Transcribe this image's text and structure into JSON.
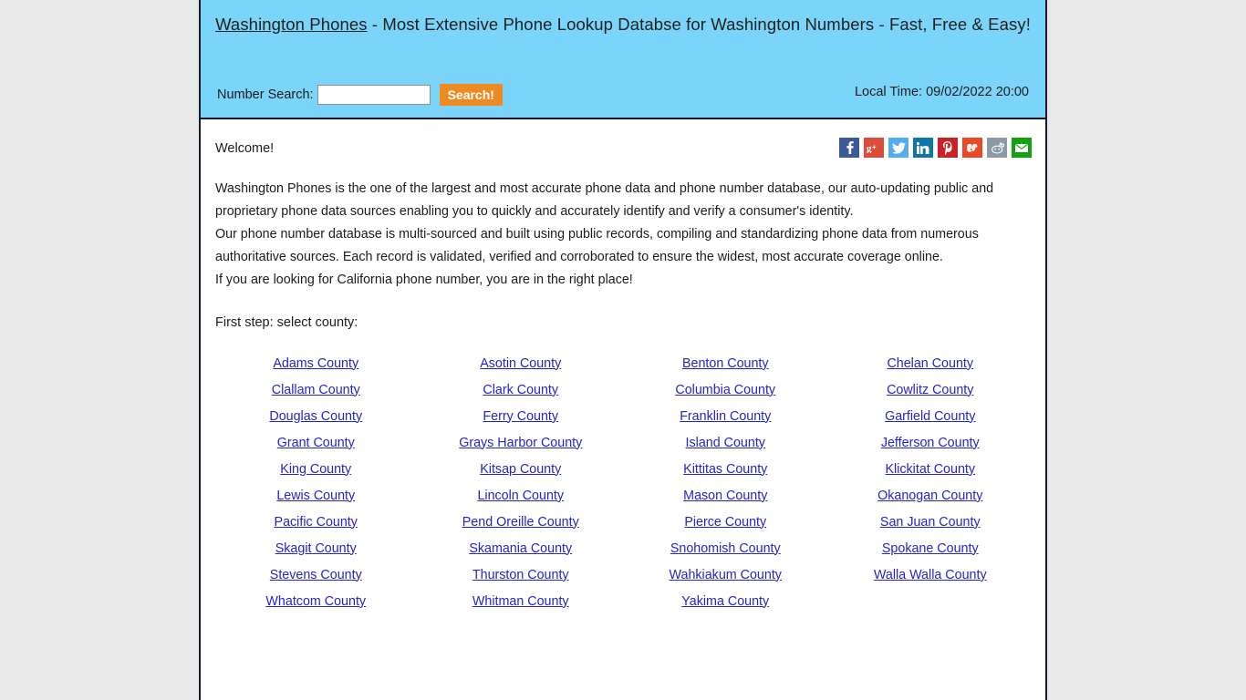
{
  "header": {
    "brand": "Washington Phones",
    "title_rest": " - Most Extensive Phone Lookup Databse for Washington Numbers - Fast, Free & Easy!",
    "search_label": "Number Search:",
    "search_value": "",
    "search_placeholder": "",
    "search_button": "Search!",
    "local_time": "Local Time: 09/02/2022 20:00",
    "colors": {
      "background": "#7bd5fb",
      "button": "#ef8a22"
    }
  },
  "content": {
    "welcome": "Welcome!",
    "paragraphs": [
      "Washington Phones is the one of the largest and most accurate phone data and phone number database, our auto-updating public and",
      "proprietary phone data sources enabling you to quickly and accurately identify and verify a consumer's identity.",
      "Our phone number database is multi-sourced and built using public records, compiling and standardizing phone data from numerous",
      "authoritative sources. Each record is validated, verified and corroborated to ensure the widest, most accurate coverage online.",
      "If you are looking for California phone number, you are in the right place!"
    ],
    "first_step": "First step: select county:",
    "link_color": "#2525c8"
  },
  "social": [
    {
      "name": "facebook-icon",
      "label": "f",
      "color": "#3b5998"
    },
    {
      "name": "googleplus-icon",
      "label": "g+",
      "color": "#dd4b39"
    },
    {
      "name": "twitter-icon",
      "label": "t",
      "color": "#55acee"
    },
    {
      "name": "linkedin-icon",
      "label": "in",
      "color": "#0e76a8"
    },
    {
      "name": "pinterest-icon",
      "label": "p",
      "color": "#cb2027"
    },
    {
      "name": "stumbleupon-icon",
      "label": "su",
      "color": "#eb4924"
    },
    {
      "name": "reddit-icon",
      "label": "r",
      "color": "#8b9aa5"
    },
    {
      "name": "email-icon",
      "label": "@",
      "color": "#13a10e"
    }
  ],
  "counties": {
    "rows": [
      [
        "Adams County",
        "Asotin County",
        "Benton County",
        "Chelan County"
      ],
      [
        "Clallam County",
        "Clark County",
        "Columbia County",
        "Cowlitz County"
      ],
      [
        "Douglas County",
        "Ferry County",
        "Franklin County",
        "Garfield County"
      ],
      [
        "Grant County",
        "Grays Harbor County",
        "Island County",
        "Jefferson County"
      ],
      [
        "King County",
        "Kitsap County",
        "Kittitas County",
        "Klickitat County"
      ],
      [
        "Lewis County",
        "Lincoln County",
        "Mason County",
        "Okanogan County"
      ],
      [
        "Pacific County",
        "Pend Oreille County",
        "Pierce County",
        "San Juan County"
      ],
      [
        "Skagit County",
        "Skamania County",
        "Snohomish County",
        "Spokane County"
      ],
      [
        "Stevens County",
        "Thurston County",
        "Wahkiakum County",
        "Walla Walla County"
      ],
      [
        "Whatcom County",
        "Whitman County",
        "Yakima County",
        ""
      ]
    ]
  }
}
